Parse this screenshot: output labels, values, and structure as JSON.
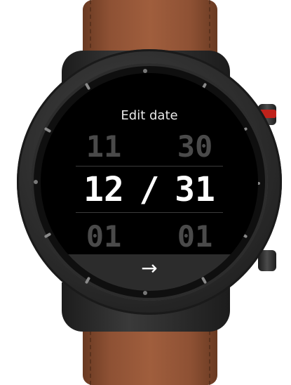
{
  "screen": {
    "title": "Edit date",
    "prev_row": {
      "month": "11",
      "day": "30"
    },
    "current_row": {
      "month": "12",
      "separator": "/",
      "day": "31"
    },
    "next_row": {
      "month": "01",
      "day": "01"
    },
    "confirm_icon": "→"
  },
  "colors": {
    "strap": "#8e5134",
    "screen_bg": "#000000",
    "active_text": "#ffffff",
    "inactive_text": "#4a4a4a",
    "button_band": "#2c2c2c",
    "crown_accent": "#c0221b"
  }
}
